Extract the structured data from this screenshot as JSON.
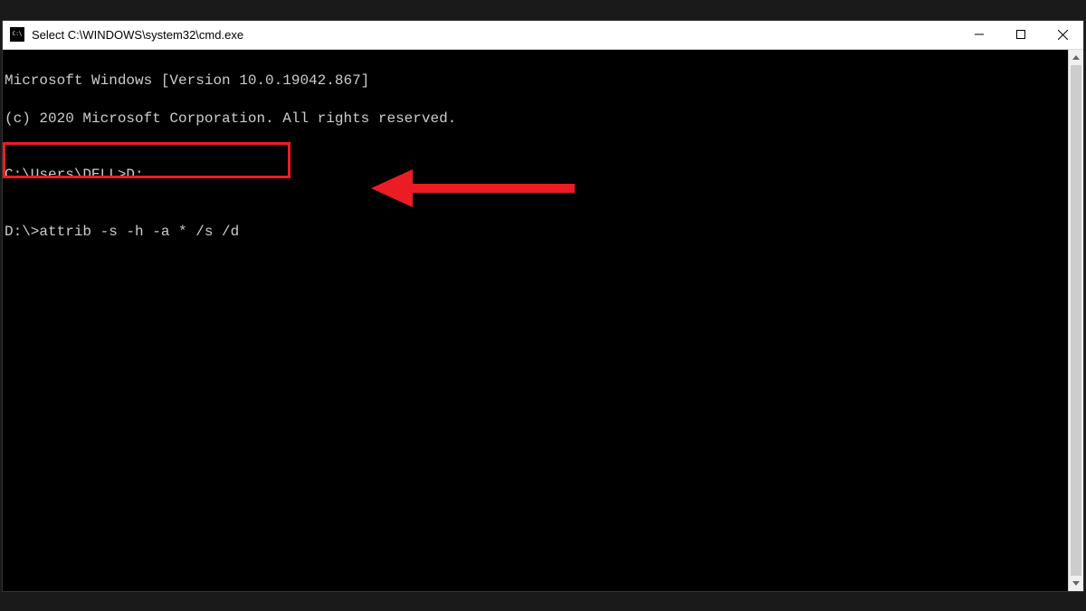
{
  "window": {
    "title": "Select C:\\WINDOWS\\system32\\cmd.exe"
  },
  "terminal": {
    "line1": "Microsoft Windows [Version 10.0.19042.867]",
    "line2": "(c) 2020 Microsoft Corporation. All rights reserved.",
    "blank1": "",
    "prompt1_path": "C:\\Users\\DELL>",
    "prompt1_cmd": "D:",
    "blank2": "",
    "prompt2_path": "D:\\>",
    "prompt2_cmd": "attrib -s -h -a * /s /d"
  },
  "annotation": {
    "highlight_color": "#eb1c24",
    "arrow_color": "#eb1c24"
  },
  "icons": {
    "minimize": "minimize-icon",
    "maximize": "maximize-icon",
    "close": "close-icon",
    "cmd": "cmd-icon",
    "scroll_up": "scroll-up-icon",
    "scroll_down": "scroll-down-icon"
  }
}
